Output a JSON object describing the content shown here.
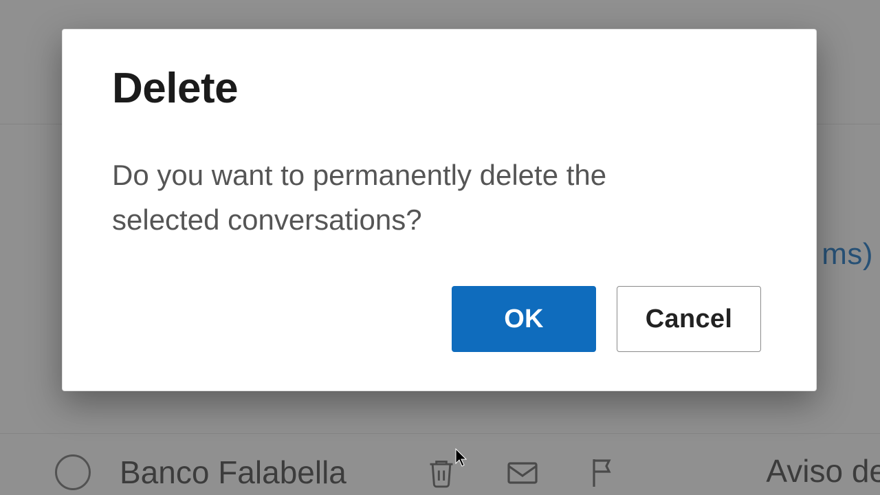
{
  "dialog": {
    "title": "Delete",
    "message": "Do you want to permanently delete the selected conversations?",
    "ok_label": "OK",
    "cancel_label": "Cancel"
  },
  "background": {
    "link_fragment": "ms)",
    "list_item_sender": "Banco Falabella",
    "subject_fragment": "Aviso de"
  },
  "colors": {
    "primary": "#0f6cbd",
    "text_dark": "#1b1b1b",
    "text_muted": "#555555"
  }
}
